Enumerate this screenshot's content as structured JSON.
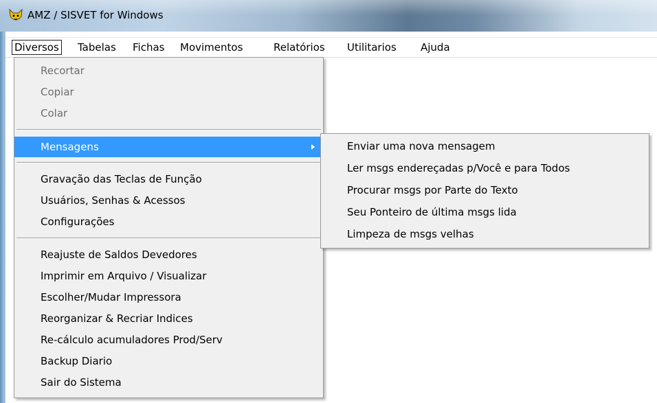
{
  "window": {
    "title": "AMZ / SISVET for Windows",
    "icon": "app-cat-icon"
  },
  "menubar": {
    "items": [
      {
        "label": "Diversos",
        "active": true
      },
      {
        "label": "Tabelas"
      },
      {
        "label": "Fichas"
      },
      {
        "label": "Movimentos"
      },
      {
        "label": "Relatórios"
      },
      {
        "label": "Utilitarios"
      },
      {
        "label": "Ajuda"
      }
    ]
  },
  "dropdown": {
    "items": [
      {
        "label": "Recortar",
        "disabled": true
      },
      {
        "label": "Copiar",
        "disabled": true
      },
      {
        "label": "Colar",
        "disabled": true
      },
      {
        "label": "Mensagens",
        "highlighted": true,
        "has_submenu": true
      },
      {
        "label": "Gravação das Teclas de Função"
      },
      {
        "label": "Usuários, Senhas & Acessos"
      },
      {
        "label": "Configurações"
      },
      {
        "label": "Reajuste de Saldos Devedores"
      },
      {
        "label": "Imprimir em Arquivo / Visualizar"
      },
      {
        "label": "Escolher/Mudar Impressora"
      },
      {
        "label": "Reorganizar & Recriar Indices"
      },
      {
        "label": "Re-cálculo acumuladores Prod/Serv"
      },
      {
        "label": "Backup Diario"
      },
      {
        "label": "Sair do Sistema"
      }
    ]
  },
  "submenu": {
    "items": [
      {
        "label": "Enviar uma nova mensagem"
      },
      {
        "label": "Ler msgs endereçadas p/Você e para Todos"
      },
      {
        "label": "Procurar msgs por Parte do Texto"
      },
      {
        "label": "Seu Ponteiro de última msgs lida"
      },
      {
        "label": "Limpeza de msgs velhas"
      }
    ]
  },
  "colors": {
    "highlight": "#3399ff",
    "menu_bg": "#f0f0f0",
    "disabled_text": "#6d6d6d"
  }
}
